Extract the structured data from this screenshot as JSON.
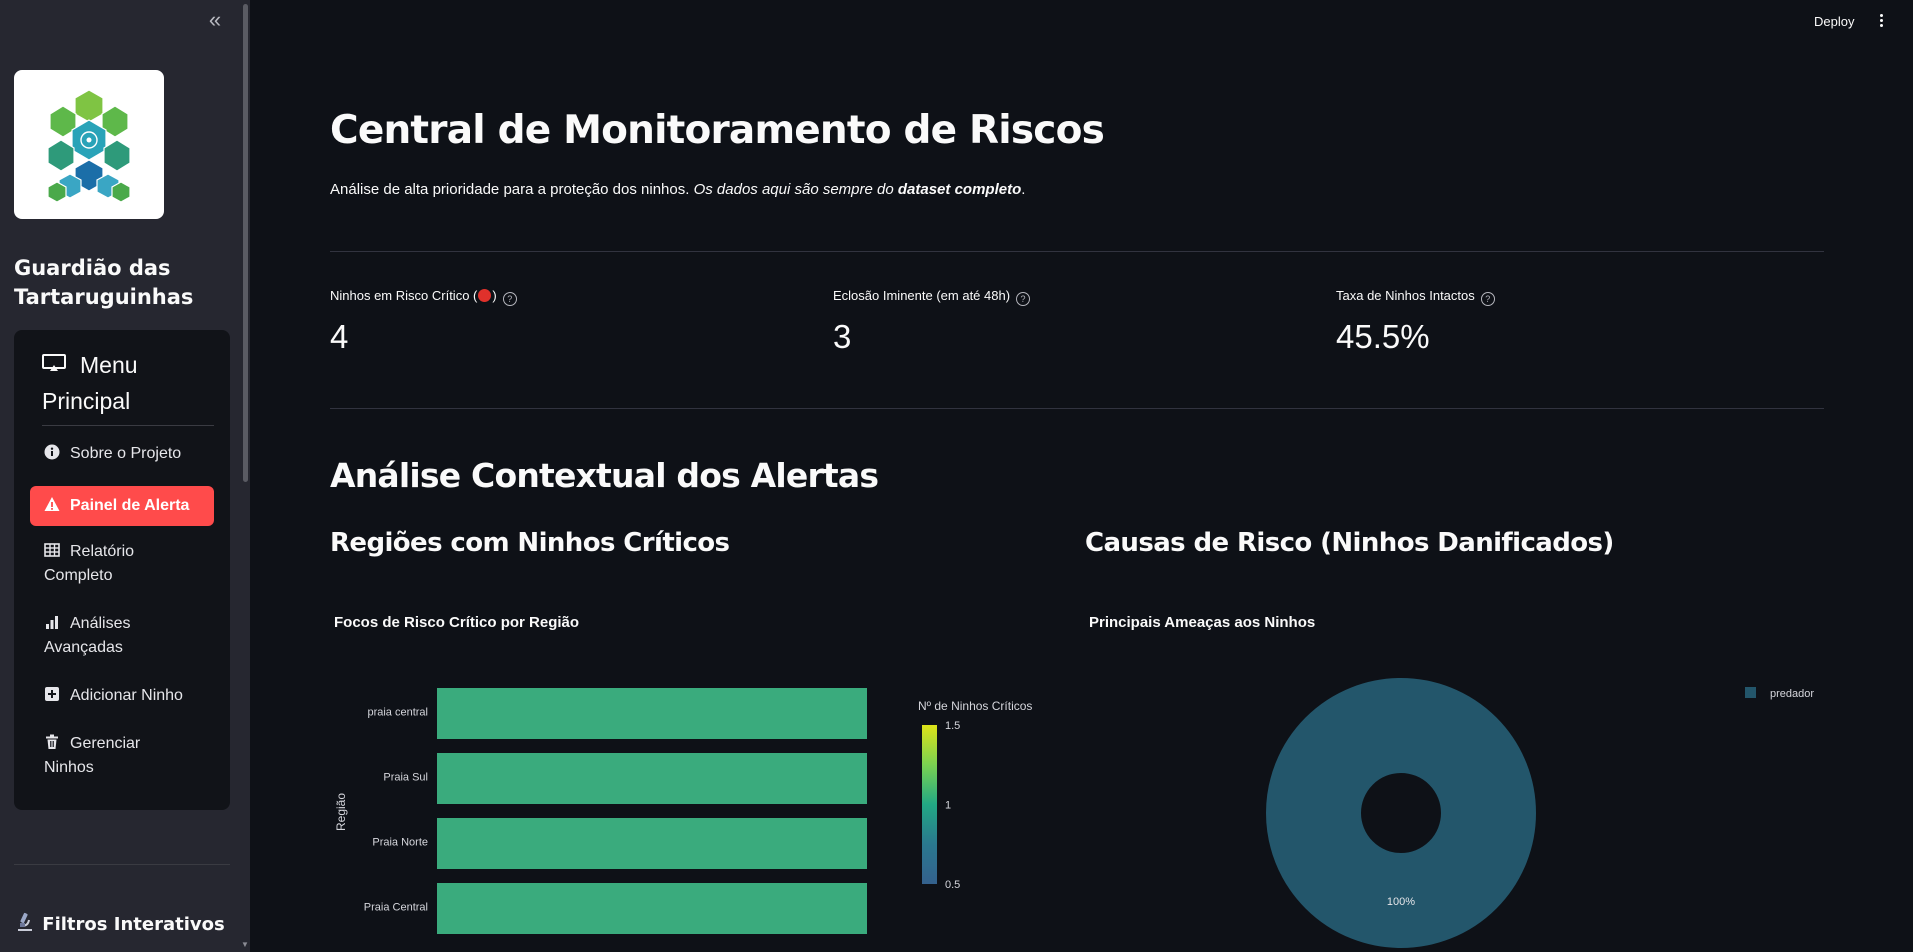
{
  "sidebar": {
    "collapse_icon": "double-chevron-left-icon",
    "app_title": "Guardião das Tartaruguinhas",
    "menu_title": "Menu Principal",
    "menu_items": [
      {
        "label": "Sobre o Projeto",
        "icon": "info-icon"
      },
      {
        "label": "Painel de Alerta",
        "icon": "warning-icon",
        "active": true
      },
      {
        "label": "Relatório Completo",
        "icon": "table-icon"
      },
      {
        "label": "Análises Avançadas",
        "icon": "bar-chart-icon"
      },
      {
        "label": "Adicionar Ninho",
        "icon": "plus-square-icon"
      },
      {
        "label": "Gerenciar Ninhos",
        "icon": "trash-icon"
      }
    ],
    "filters_title": "Filtros Interativos"
  },
  "header": {
    "deploy_label": "Deploy",
    "menu_icon": "kebab-icon"
  },
  "main": {
    "title": "Central de Monitoramento de Riscos",
    "subtitle": {
      "plain": "Análise de alta prioridade para a proteção dos ninhos. ",
      "italic": "Os dados aqui são sempre do ",
      "bold_italic": "dataset completo",
      "end": "."
    },
    "metrics": [
      {
        "label_before": "Ninhos em Risco Crítico (",
        "label_after": ")",
        "value": "4",
        "has_red_dot": true
      },
      {
        "label_before": "Eclosão Iminente (em até 48h)",
        "label_after": "",
        "value": "3",
        "has_red_dot": false
      },
      {
        "label_before": "Taxa de Ninhos Intactos",
        "label_after": "",
        "value": "45.5%",
        "has_red_dot": false
      }
    ],
    "section_title": "Análise Contextual dos Alertas",
    "left_heading": "Regiões com Ninhos Críticos",
    "right_heading": "Causas de Risco (Ninhos Danificados)"
  },
  "colors": {
    "accent": "#ff4b4b",
    "bar": "#3aab7d",
    "donut": "#23566b",
    "background": "#0e1117",
    "sidebar": "#262730"
  },
  "chart_data": [
    {
      "type": "bar",
      "orientation": "horizontal",
      "title": "Focos de Risco Crítico por Região",
      "ylabel": "Região",
      "categories": [
        "praia central",
        "Praia Sul",
        "Praia Norte",
        "Praia Central"
      ],
      "values": [
        1,
        1,
        1,
        1
      ],
      "colorbar": {
        "title": "Nº de Ninhos Críticos",
        "ticks": [
          "1.5",
          "1",
          "0.5"
        ],
        "range": [
          0.5,
          1.5
        ]
      }
    },
    {
      "type": "pie",
      "donut": true,
      "title": "Principais Ameaças aos Ninhos",
      "labels": [
        "predador"
      ],
      "values": [
        100
      ],
      "slice_label": "100%",
      "legend": "top-right"
    }
  ]
}
